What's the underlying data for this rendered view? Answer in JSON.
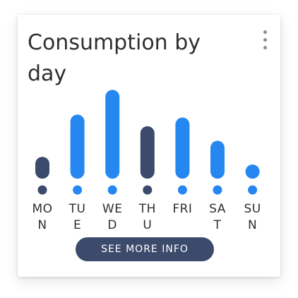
{
  "card": {
    "title": "Consumption by day",
    "menu_icon": "vertical-ellipsis-icon",
    "button_label": "SEE MORE INFO"
  },
  "colors": {
    "highlight": "#2687f0",
    "normal": "#3c4a6b",
    "button": "#3c4a6b"
  },
  "chart_data": {
    "type": "bar",
    "categories": [
      "MON",
      "TUE",
      "WED",
      "THU",
      "FRI",
      "SAT",
      "SUN"
    ],
    "values": [
      30,
      88,
      122,
      72,
      84,
      52,
      18
    ],
    "highlighted": [
      false,
      true,
      true,
      false,
      true,
      true,
      true
    ],
    "ylim": [
      0,
      130
    ],
    "grid": false
  }
}
